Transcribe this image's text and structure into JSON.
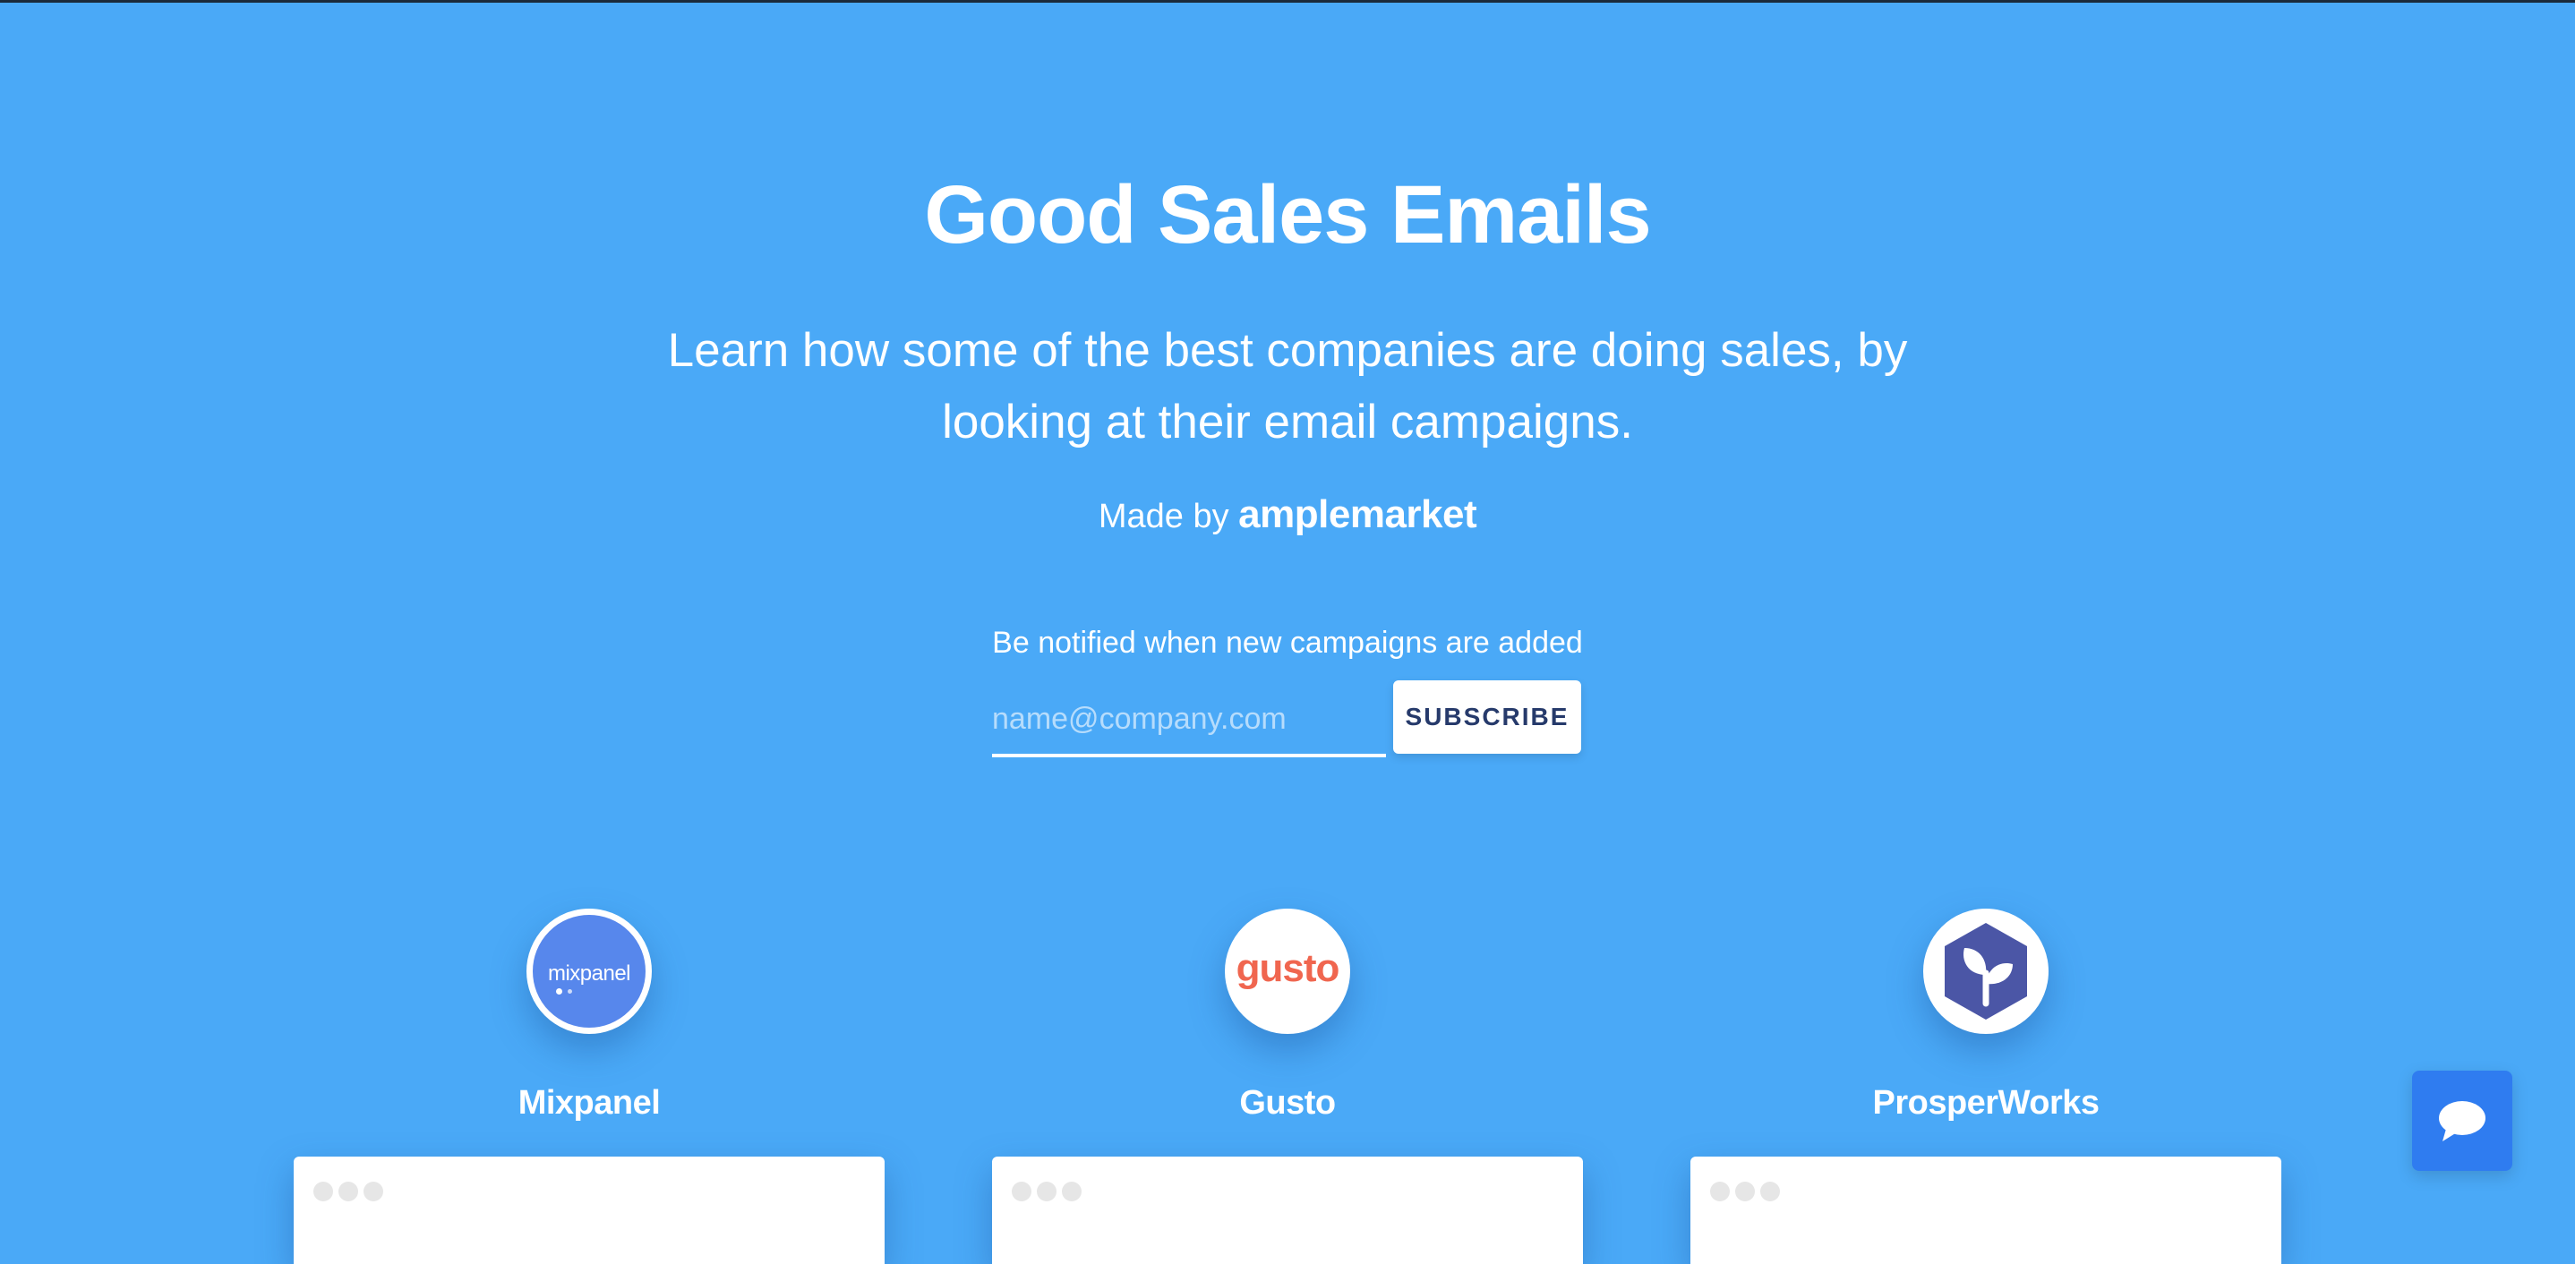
{
  "hero": {
    "title": "Good Sales Emails",
    "subtitle": "Learn how some of the best companies are doing sales, by looking at their email campaigns.",
    "made_by_prefix": "Made by",
    "made_by_brand": "amplemarket"
  },
  "subscribe": {
    "label": "Be notified when new campaigns are added",
    "placeholder": "name@company.com",
    "button_label": "SUBSCRIBE"
  },
  "companies": [
    {
      "name": "Mixpanel",
      "logo_text": "mixpanel",
      "logo_color": "#5787ec"
    },
    {
      "name": "Gusto",
      "logo_text": "gusto",
      "logo_color": "#f0664f"
    },
    {
      "name": "ProsperWorks",
      "logo_icon": "leaf-icon",
      "logo_color": "#4b56a6"
    }
  ],
  "chat": {
    "icon": "chat-bubble-icon"
  },
  "colors": {
    "background": "#4aa9f7",
    "button_text": "#263a6b",
    "chat_button": "#2f7cf0"
  }
}
